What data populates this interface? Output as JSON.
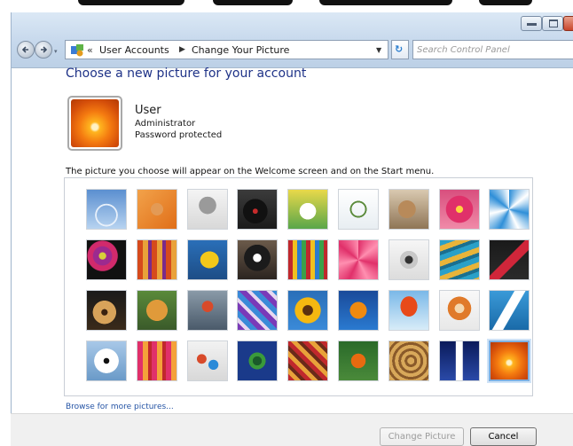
{
  "window": {
    "title_bar_buttons": [
      "minimize",
      "maximize",
      "close"
    ],
    "accent_color": "#1e3287"
  },
  "nav": {
    "back_icon": "back-arrow-icon",
    "forward_icon": "forward-arrow-icon"
  },
  "address_bar": {
    "overflow": "«",
    "crumbs": [
      "User Accounts",
      "Change Your Picture"
    ],
    "icon": "control-panel-icon"
  },
  "search": {
    "placeholder": "Search Control Panel"
  },
  "page": {
    "heading": "Choose a new picture for your account",
    "description": "The picture you choose will appear on the Welcome screen and on the Start menu.",
    "browse_link": "Browse for more pictures..."
  },
  "user": {
    "name": "User",
    "role": "Administrator",
    "status": "Password protected"
  },
  "pictures": {
    "rows": [
      [
        "ferris-wheel",
        "starfish",
        "robot",
        "turntable",
        "lucky-cat",
        "gyroscope",
        "kitten",
        "pink-flower",
        "pinwheel"
      ],
      [
        "sphere",
        "woven-fabric",
        "yellow-leaf",
        "border-collie",
        "crayons",
        "pink-star-flower",
        "jacks",
        "stairs",
        "origami-crane"
      ],
      [
        "guitar",
        "pomeranian",
        "toy-robot",
        "painted-fabric",
        "sunflower",
        "orange-fish",
        "hot-air-balloon",
        "matryoshka",
        "sailboat"
      ],
      [
        "soccer-ball",
        "striped-fabric",
        "marbles",
        "framed-window",
        "patterned-rug",
        "butterfly",
        "nautilus-shell",
        "lighthouse",
        "orange-daisy"
      ]
    ],
    "selected": "orange-daisy"
  },
  "buttons": {
    "change": "Change Picture",
    "cancel": "Cancel"
  }
}
